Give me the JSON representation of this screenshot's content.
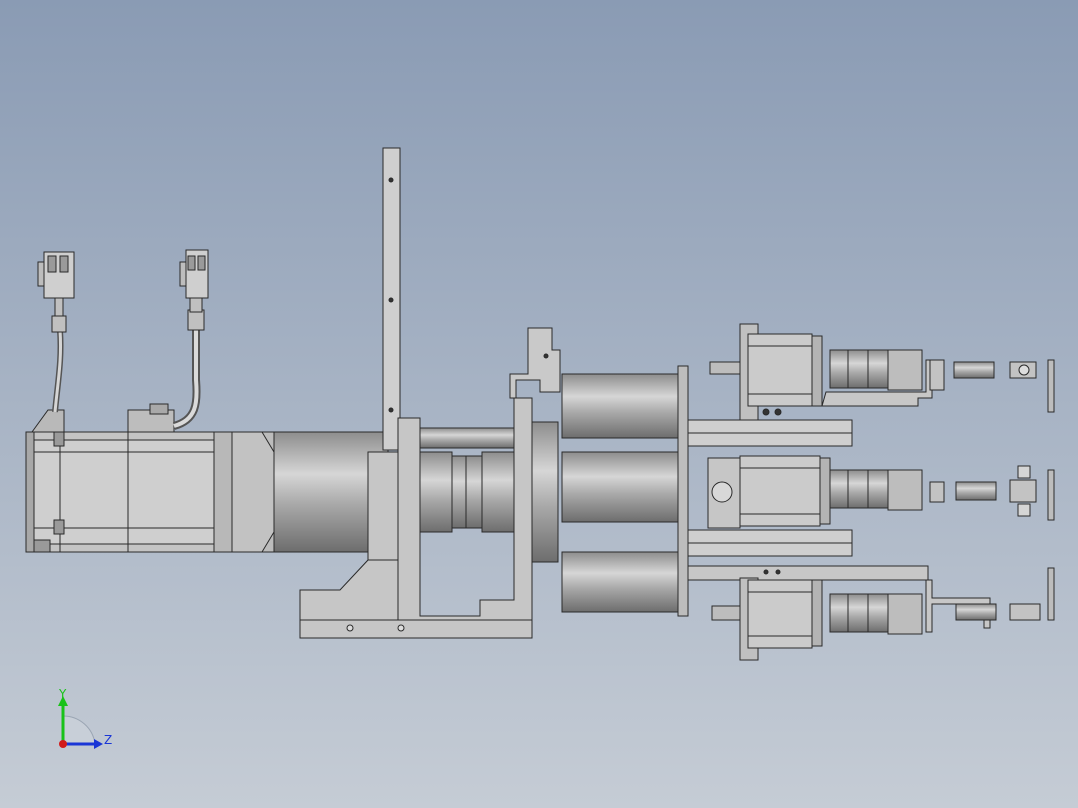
{
  "viewport": {
    "background_top": "#8a9bb4",
    "background_bottom": "#c5ccd5",
    "model_fill": "#c8c8c8",
    "model_dark": "#7a7a7a",
    "model_stroke": "#2a2a2a"
  },
  "triad": {
    "y_label": "Y",
    "z_label": "Z",
    "y_color": "#19c219",
    "z_color": "#1a36d6",
    "x_color": "#d11a1a"
  }
}
